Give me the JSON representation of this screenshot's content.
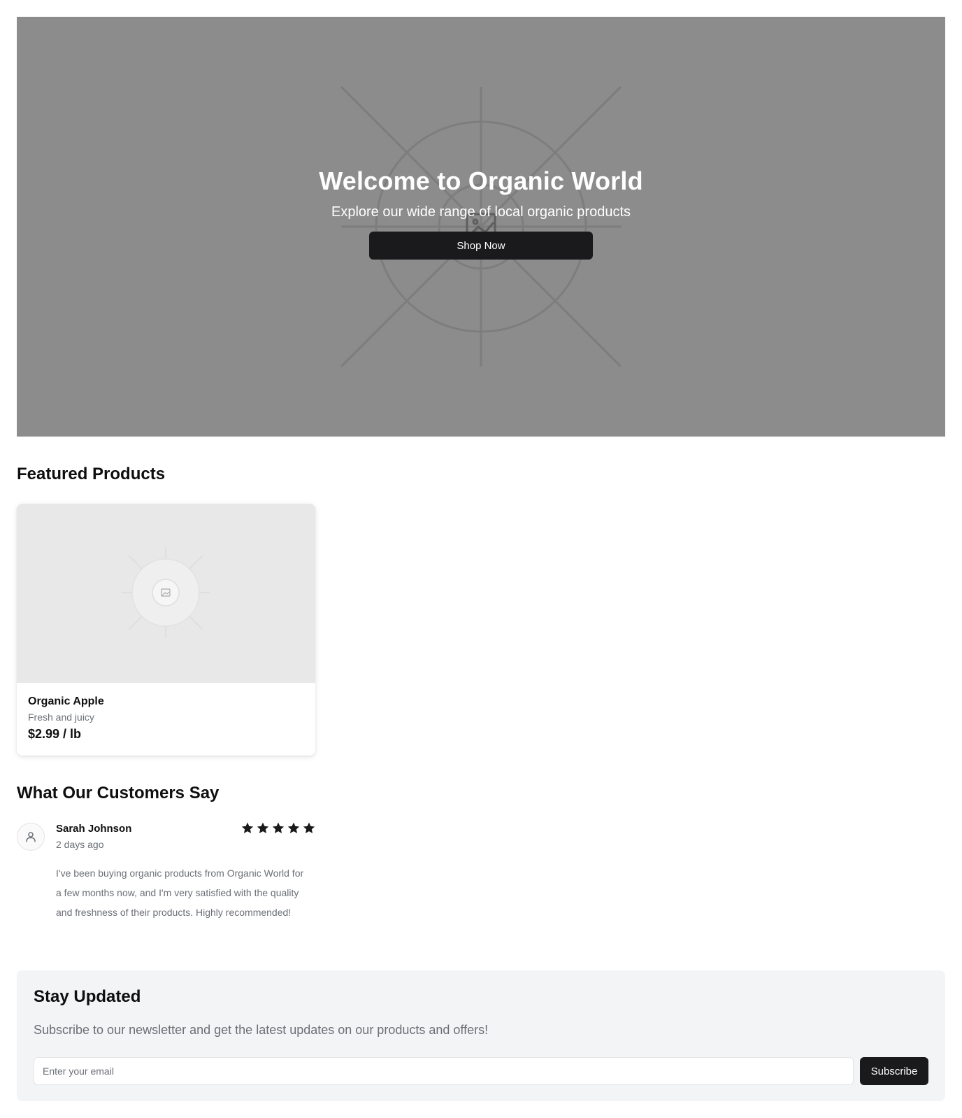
{
  "hero": {
    "title": "Welcome to Organic World",
    "subtitle": "Explore our wide range of local organic products",
    "cta_label": "Shop Now",
    "background_color": "#8c8c8c",
    "placeholder_icon": "image-placeholder-icon"
  },
  "featured": {
    "heading": "Featured Products",
    "products": [
      {
        "name": "Organic Apple",
        "description": "Fresh and juicy",
        "price": "$2.99 / lb",
        "image_icon": "image-placeholder-icon"
      }
    ]
  },
  "reviews": {
    "heading": "What Our Customers Say",
    "items": [
      {
        "name": "Sarah Johnson",
        "time": "2 days ago",
        "rating": 5,
        "rating_max": 5,
        "avatar_icon": "user-icon",
        "text": "I've been buying organic products from Organic World for a few months now, and I'm very satisfied with the quality and freshness of their products. Highly recommended!"
      }
    ]
  },
  "newsletter": {
    "heading": "Stay Updated",
    "text": "Subscribe to our newsletter and get the latest updates on our products and offers!",
    "input_placeholder": "Enter your email",
    "input_value": "",
    "button_label": "Subscribe"
  },
  "colors": {
    "primary_button": "#1a1a1c",
    "muted_text": "#6b6f76",
    "newsletter_bg": "#f3f4f6"
  }
}
